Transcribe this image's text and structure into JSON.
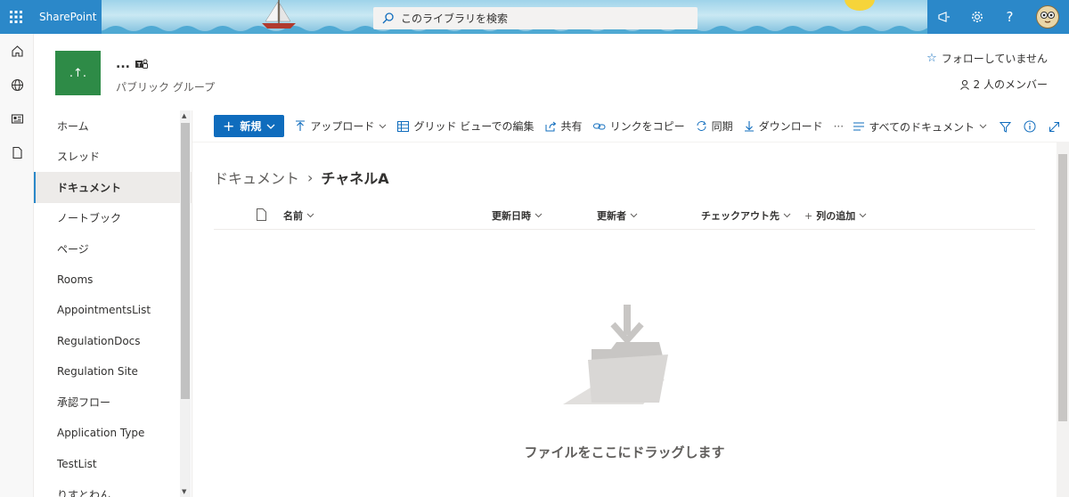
{
  "suitebar": {
    "app_name": "SharePoint",
    "search_placeholder": "このライブラリを検索",
    "icons": [
      "waffle-icon",
      "megaphone-icon",
      "gear-icon",
      "help-icon"
    ],
    "help_label": "?",
    "accent_color": "#2b88c9"
  },
  "appbar": {
    "items": [
      "home-icon",
      "globe-icon",
      "news-icon",
      "file-icon"
    ]
  },
  "site": {
    "logo_text": ".↑.",
    "title": "...",
    "privacy": "パブリック グループ",
    "follow": "フォローしていません",
    "members": "2 人のメンバー",
    "logo_color": "#2e8b47"
  },
  "leftnav": {
    "items": [
      {
        "label": "ホーム"
      },
      {
        "label": "スレッド"
      },
      {
        "label": "ドキュメント",
        "active": true
      },
      {
        "label": "ノートブック"
      },
      {
        "label": "ページ"
      },
      {
        "label": "Rooms"
      },
      {
        "label": "AppointmentsList"
      },
      {
        "label": "RegulationDocs"
      },
      {
        "label": "Regulation Site"
      },
      {
        "label": "承認フロー"
      },
      {
        "label": "Application Type"
      },
      {
        "label": "TestList"
      },
      {
        "label": "りすとわん"
      }
    ]
  },
  "commandbar": {
    "new_label": "新規",
    "upload": "アップロード",
    "grid_edit": "グリッド ビューでの編集",
    "share": "共有",
    "copy_link": "リンクをコピー",
    "sync": "同期",
    "download": "ダウンロード",
    "more": "···",
    "view": "すべてのドキュメント"
  },
  "breadcrumb": {
    "root": "ドキュメント",
    "separator": "›",
    "current": "チャネルA"
  },
  "columns": {
    "name": "名前",
    "modified": "更新日時",
    "modified_by": "更新者",
    "checked_out_to": "チェックアウト先",
    "add_column": "列の追加"
  },
  "empty_state": {
    "text": "ファイルをここにドラッグします"
  }
}
